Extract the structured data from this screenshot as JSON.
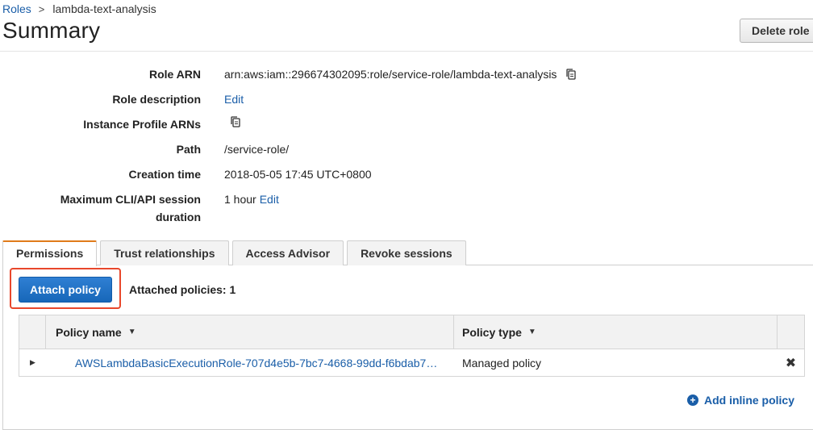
{
  "breadcrumb": {
    "root": "Roles",
    "separator": ">",
    "current": "lambda-text-analysis"
  },
  "page": {
    "title": "Summary",
    "delete_label": "Delete role"
  },
  "summary": {
    "role_arn": {
      "label": "Role ARN",
      "value": "arn:aws:iam::296674302095:role/service-role/lambda-text-analysis"
    },
    "role_description": {
      "label": "Role description",
      "link": "Edit"
    },
    "instance_profile": {
      "label": "Instance Profile ARNs"
    },
    "path": {
      "label": "Path",
      "value": "/service-role/"
    },
    "creation_time": {
      "label": "Creation time",
      "value": "2018-05-05 17:45 UTC+0800"
    },
    "max_session": {
      "label_line1": "Maximum CLI/API session",
      "label_line2": "duration",
      "value": "1 hour",
      "link": "Edit"
    }
  },
  "tabs": [
    {
      "label": "Permissions",
      "active": true
    },
    {
      "label": "Trust relationships",
      "active": false
    },
    {
      "label": "Access Advisor",
      "active": false
    },
    {
      "label": "Revoke sessions",
      "active": false
    }
  ],
  "permissions": {
    "attach_label": "Attach policy",
    "attached_count_text": "Attached policies: 1",
    "table": {
      "columns": [
        "Policy name",
        "Policy type"
      ],
      "rows": [
        {
          "name": "AWSLambdaBasicExecutionRole-707d4e5b-7bc7-4668-99dd-f6bdab7…",
          "type": "Managed policy",
          "action": "✖"
        }
      ]
    },
    "add_inline_label": "Add inline policy"
  },
  "colors": {
    "link": "#1a5ea8",
    "primary_button": "#1767b9",
    "active_tab_accent": "#e07b1a",
    "highlight_box": "#e8472b"
  },
  "icons": {
    "copy": "copy-icon",
    "expand": "caret-right-icon",
    "sort": "caret-down-icon",
    "remove": "close-icon",
    "add": "plus-circle-icon"
  }
}
